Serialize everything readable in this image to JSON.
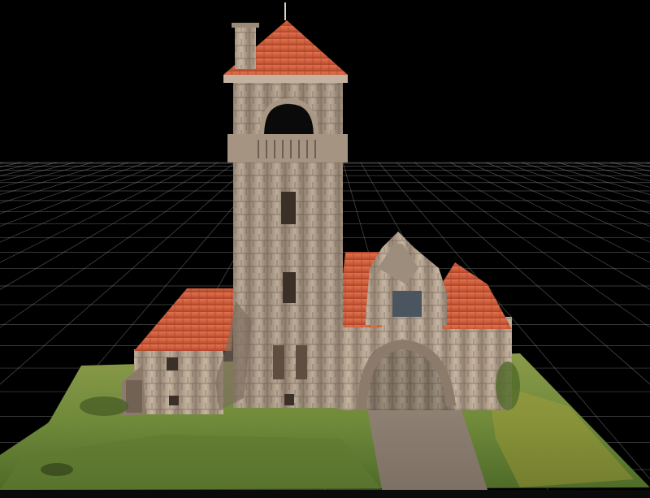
{
  "viewer": {
    "background": "#000000",
    "grid_color": "#8a8a8a",
    "colors": {
      "roof": "#d9603c",
      "roof_dark": "#a8412a",
      "stone": "#b5a593",
      "stone_dark": "#7d6e60",
      "grass": "#6f8a3a",
      "grass_dark": "#4a5f26",
      "path": "#8a7d70"
    }
  }
}
